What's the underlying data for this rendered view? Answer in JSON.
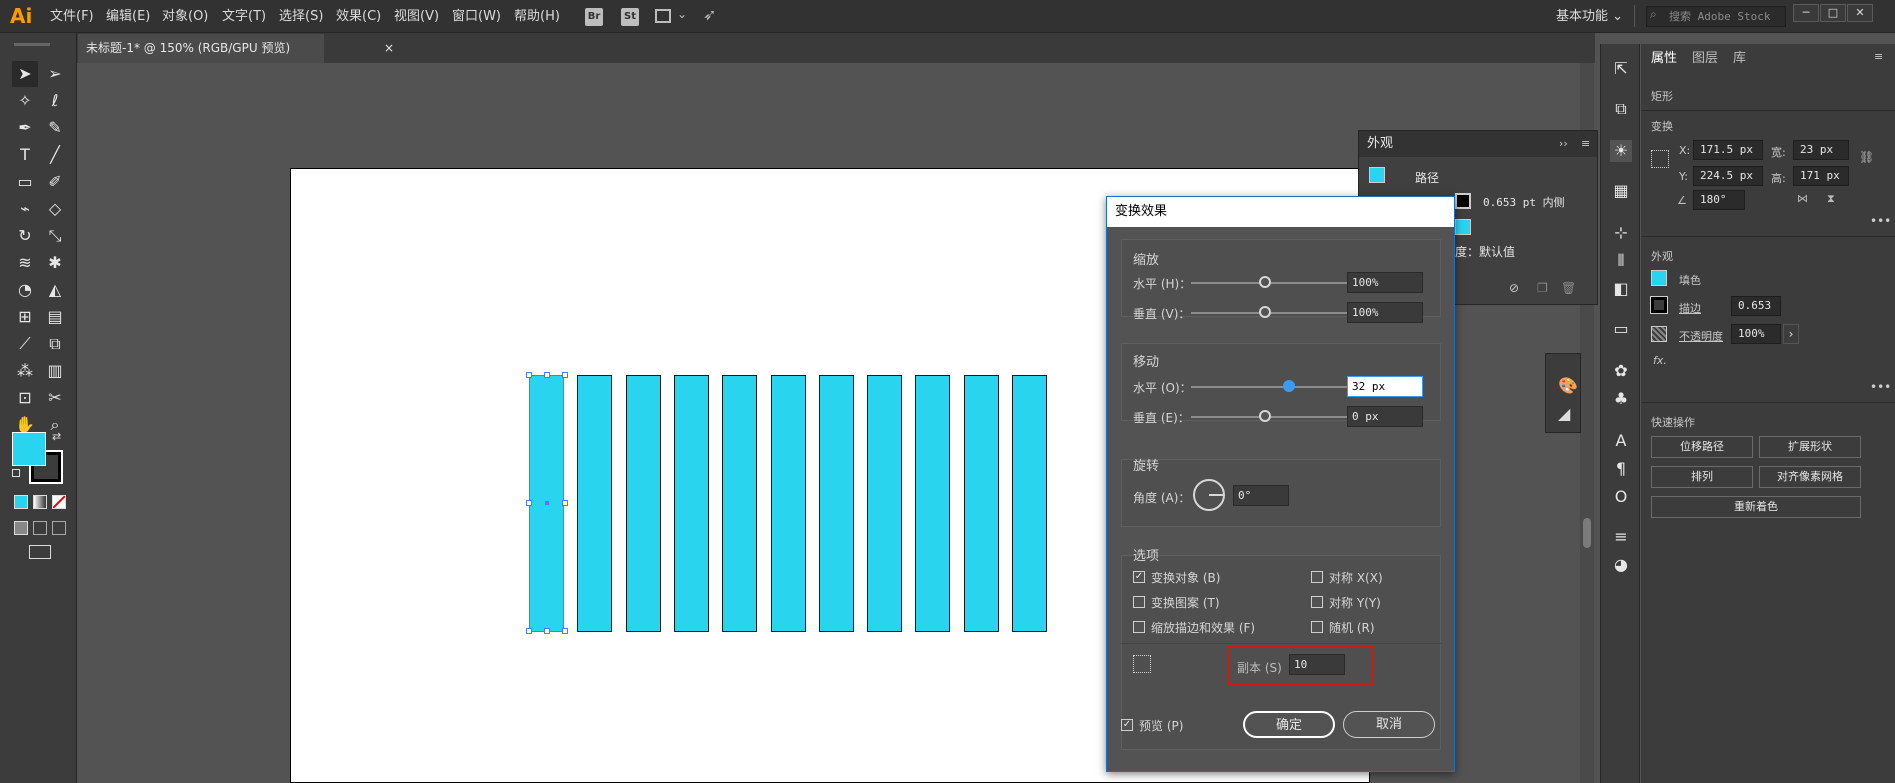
{
  "app": {
    "logo": "Ai"
  },
  "menu": [
    "文件(F)",
    "编辑(E)",
    "对象(O)",
    "文字(T)",
    "选择(S)",
    "效果(C)",
    "视图(V)",
    "窗口(W)",
    "帮助(H)"
  ],
  "menubar_icons": {
    "br": "Br",
    "st": "St"
  },
  "workspace": "基本功能",
  "search_placeholder": "搜索 Adobe Stock",
  "window_controls": {
    "minimize": "─",
    "restore": "□",
    "close": "✕"
  },
  "document_tab": {
    "title": "未标题-1* @ 150% (RGB/GPU 预览)",
    "close": "×"
  },
  "swatch_colors": {
    "fill": "#29d4ee",
    "stroke": "#000000"
  },
  "artwork": {
    "rect_count": 11,
    "fill_color": "#29d4ee"
  },
  "appearance_panel": {
    "title": "外观",
    "object": "路径",
    "stroke_value": "0.653 pt  内侧",
    "opacity_row": "度：默认值"
  },
  "properties_panel": {
    "tabs": [
      "属性",
      "图层",
      "库"
    ],
    "object_type": "矩形",
    "transform_title": "变换",
    "x_label": "X:",
    "x": "171.5 px",
    "y_label": "Y:",
    "y": "224.5 px",
    "w_label": "宽:",
    "w": "23 px",
    "h_label": "高:",
    "h": "171 px",
    "angle": "180°",
    "appearance_title": "外观",
    "fill_label": "填色",
    "stroke_label": "描边",
    "stroke_value": "0.653",
    "opacity_label": "不透明度",
    "opacity_value": "100%",
    "fx": "fx.",
    "quick_title": "快速操作",
    "btn_offset": "位移路径",
    "btn_expand": "扩展形状",
    "btn_arrange": "排列",
    "btn_pixel": "对齐像素网格",
    "btn_recolor": "重新着色"
  },
  "dialog": {
    "title": "变换效果",
    "scale_group": "缩放",
    "scale_h_label": "水平 (H)：",
    "scale_h": "100%",
    "scale_v_label": "垂直 (V)：",
    "scale_v": "100%",
    "move_group": "移动",
    "move_h_label": "水平 (O)：",
    "move_h": "32 px",
    "move_v_label": "垂直 (E)：",
    "move_v": "0 px",
    "rotate_group": "旋转",
    "angle_label": "角度 (A)：",
    "angle": "0°",
    "options_group": "选项",
    "opt_transform_objects": "变换对象 (B)",
    "opt_transform_patterns": "变换图案 (T)",
    "opt_scale_strokes": "缩放描边和效果 (F)",
    "opt_reflect_x": "对称 X(X)",
    "opt_reflect_y": "对称 Y(Y)",
    "opt_random": "随机 (R)",
    "copies_label": "副本 (S)",
    "copies": "10",
    "preview_label": "预览 (P)",
    "ok": "确定",
    "cancel": "取消",
    "check_mark": "✓"
  }
}
